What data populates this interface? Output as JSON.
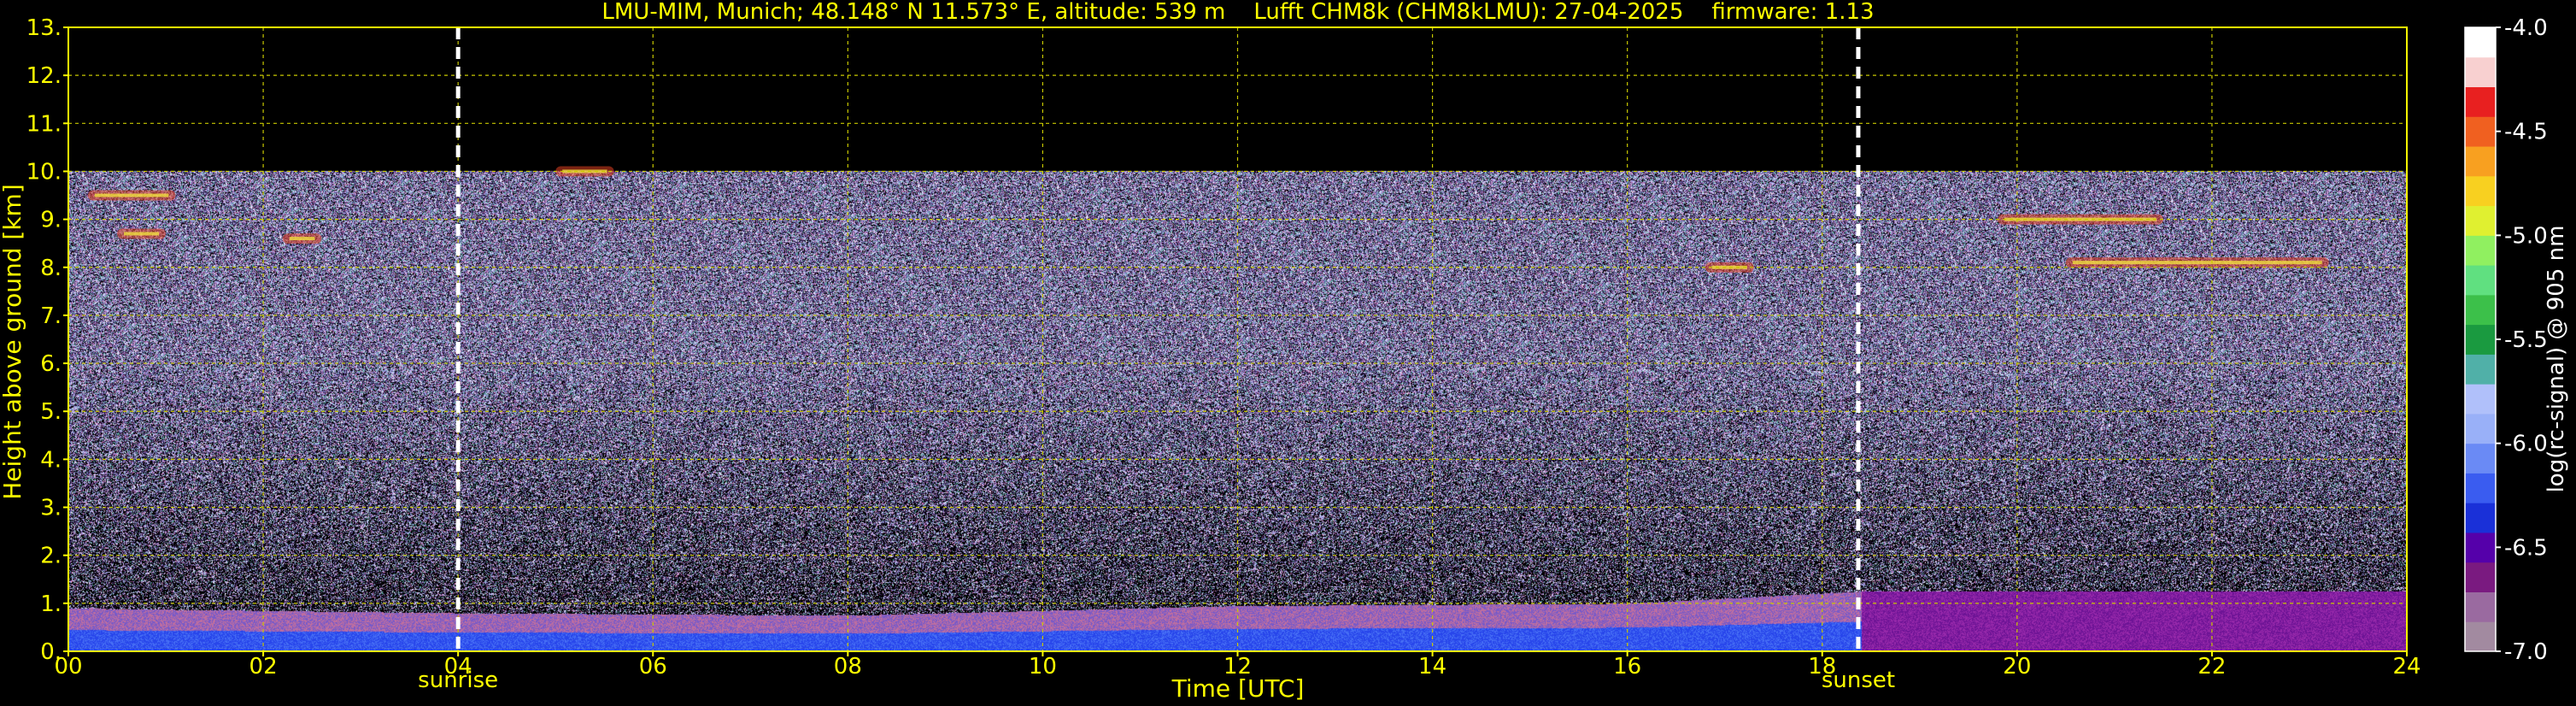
{
  "chart_data": {
    "type": "heatmap",
    "title": "LMU-MIM, Munich; 48.148° N 11.573° E, altitude: 539 m    Lufft CHM8k (CHM8kLMU): 27-04-2025    firmware: 1.13",
    "xlabel": "Time [UTC]",
    "ylabel": "Height above ground [km]",
    "xlim": [
      0,
      24
    ],
    "ylim": [
      0,
      13
    ],
    "x_ticks": [
      "00",
      "02",
      "04",
      "06",
      "08",
      "10",
      "12",
      "14",
      "16",
      "18",
      "20",
      "22",
      "24"
    ],
    "y_ticks": [
      "0.",
      "1.",
      "2.",
      "3.",
      "4.",
      "5.",
      "6.",
      "7.",
      "8.",
      "9.",
      "10.",
      "11.",
      "12.",
      "13."
    ],
    "grid": true,
    "annotations": [
      {
        "label": "sunrise",
        "x": 4.0
      },
      {
        "label": "sunset",
        "x": 18.37
      }
    ],
    "data_top_km": 10.0,
    "boundary_layer": [
      {
        "time": 0,
        "height_km": 0.9
      },
      {
        "time": 4,
        "height_km": 0.8
      },
      {
        "time": 8,
        "height_km": 0.75
      },
      {
        "time": 12,
        "height_km": 0.95
      },
      {
        "time": 16,
        "height_km": 1.0
      },
      {
        "time": 18.4,
        "height_km": 1.25
      },
      {
        "time": 24,
        "height_km": 1.25
      }
    ],
    "cloud_features": [
      {
        "time_start": 0.2,
        "time_end": 1.1,
        "height_km": 9.5
      },
      {
        "time_start": 0.5,
        "time_end": 1.0,
        "height_km": 8.7
      },
      {
        "time_start": 2.2,
        "time_end": 2.6,
        "height_km": 8.6
      },
      {
        "time_start": 5.0,
        "time_end": 5.6,
        "height_km": 10.0
      },
      {
        "time_start": 16.8,
        "time_end": 17.3,
        "height_km": 8.0
      },
      {
        "time_start": 19.8,
        "time_end": 21.5,
        "height_km": 9.0
      },
      {
        "time_start": 20.5,
        "time_end": 23.2,
        "height_km": 8.1
      }
    ],
    "colorbar": {
      "label": "log(rc-signal) @ 905 nm",
      "ticks": [
        "-4.0",
        "-4.5",
        "-5.0",
        "-5.5",
        "-6.0",
        "-6.5",
        "-7.0"
      ],
      "range": [
        -7.0,
        -4.0
      ],
      "colors": [
        "#a28aa0",
        "#9a6aa0",
        "#7a1a80",
        "#5500aa",
        "#1a30d8",
        "#3a5cf0",
        "#6a8af5",
        "#99b0f8",
        "#b0c0fa",
        "#50b0a8",
        "#1a9a40",
        "#3cc04a",
        "#60e080",
        "#90f060",
        "#e0f030",
        "#f8d020",
        "#f8a020",
        "#f06020",
        "#e82020",
        "#f8d0d0",
        "#ffffff"
      ]
    },
    "title_color": "#ffff00",
    "axis_color": "#ffff00",
    "grid_color": "#c8c800",
    "background": "#000000"
  }
}
